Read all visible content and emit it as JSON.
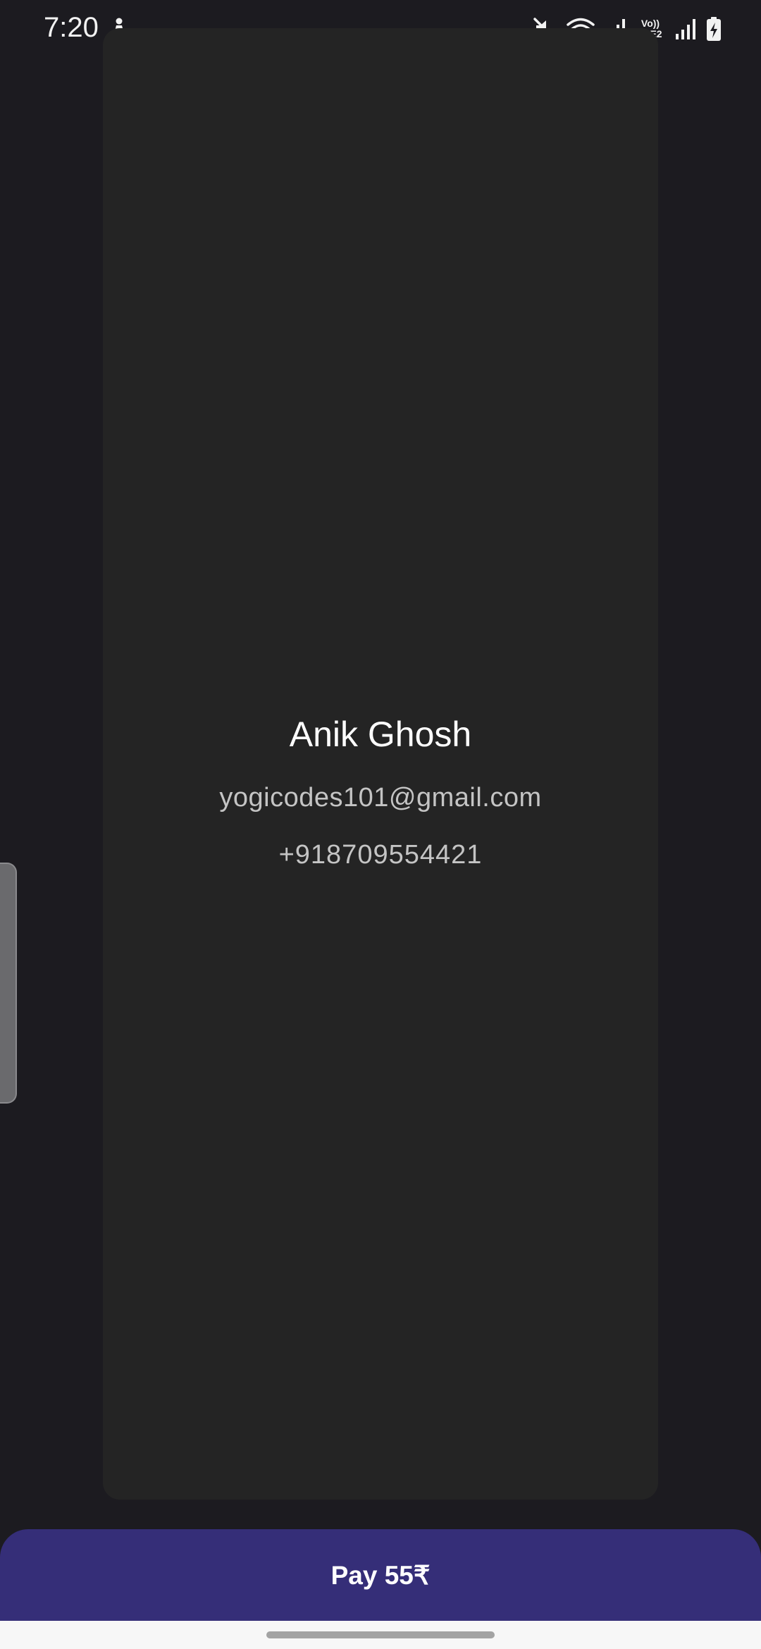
{
  "status_bar": {
    "time": "7:20",
    "left_icon": "accessibility-figure-icon",
    "icons": [
      "mute-icon",
      "wifi-icon",
      "signal-icon",
      "volte-lte2-icon",
      "signal-icon",
      "battery-charging-icon"
    ],
    "lte_line1": "Vo))",
    "lte_line2": "LTE2"
  },
  "profile": {
    "name": "Anik Ghosh",
    "email": "yogicodes101@gmail.com",
    "phone": "+918709554421"
  },
  "pay_button": {
    "label": "Pay 55₹"
  },
  "colors": {
    "background": "#1c1b20",
    "card": "#242424",
    "pay_button": "#352e78",
    "secondary_text": "#c4c4c4"
  }
}
